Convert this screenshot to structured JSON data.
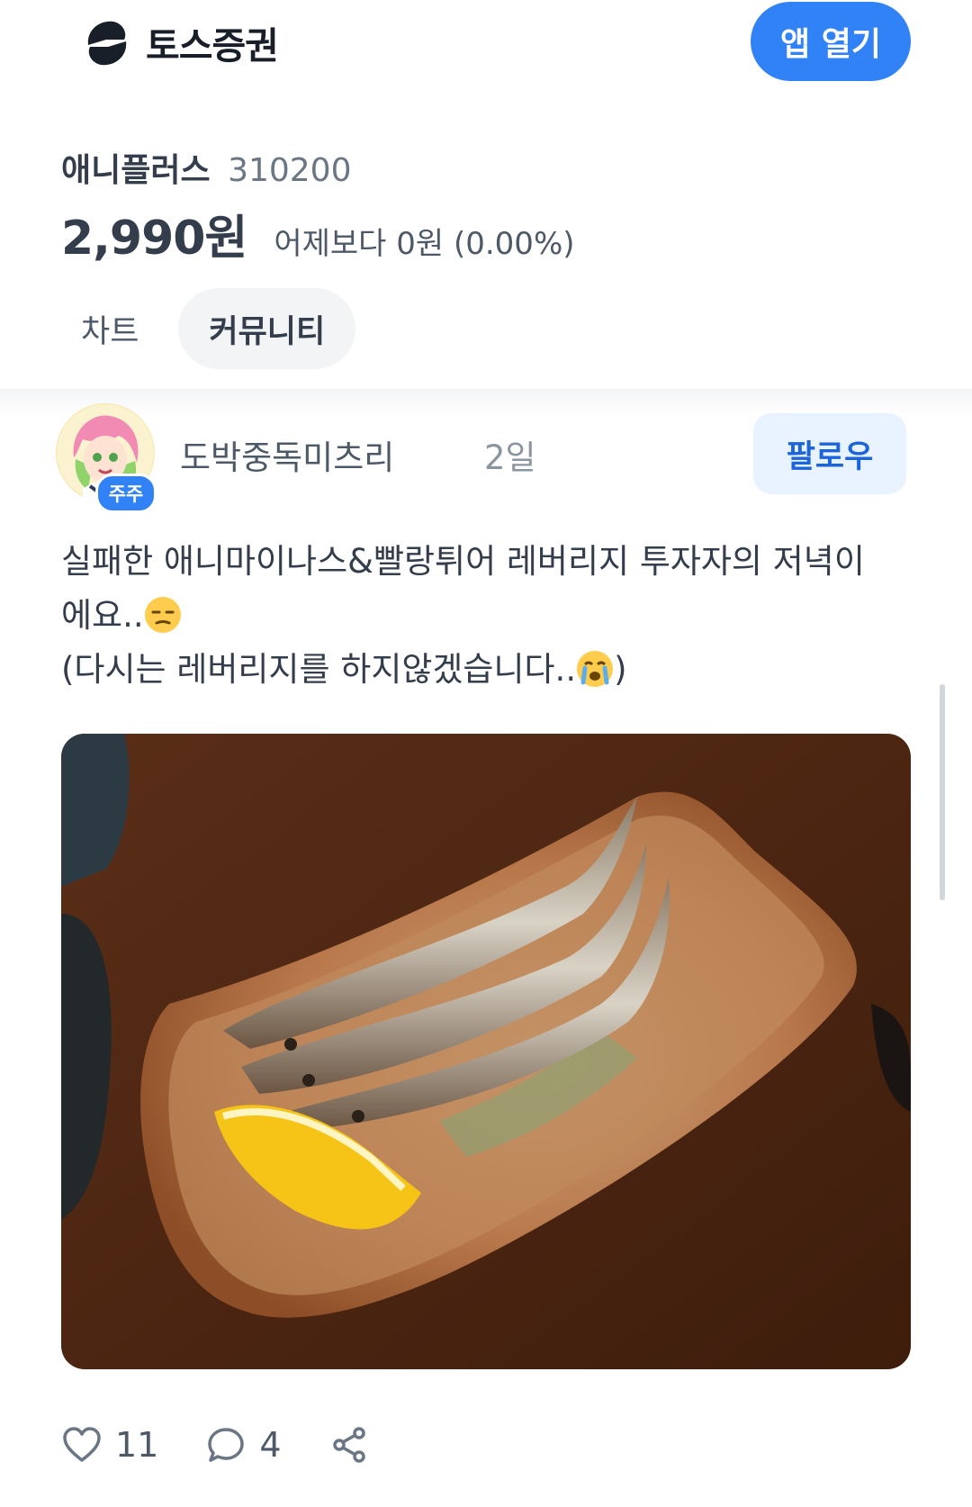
{
  "header": {
    "brand": "토스증권",
    "open_app_label": "앱 열기",
    "brand_color": "#3182f6"
  },
  "stock": {
    "name": "애니플러스",
    "code": "310200",
    "price": "2,990원",
    "change": "어제보다 0원 (0.00%)"
  },
  "tabs": [
    {
      "label": "차트",
      "active": false
    },
    {
      "label": "커뮤니티",
      "active": true
    }
  ],
  "post": {
    "author": "도박중독미츠리",
    "holder_badge": "주주",
    "time": "2일",
    "follow_label": "팔로우",
    "lines": [
      "실패한 애니마이나스&빨랑튀어 레버리지 투자자의 저녁이",
      "에요..",
      "(다시는 레버리지를 하지않겠습니다..",
      ")"
    ],
    "emoji": [
      "unamused-face-icon",
      "crying-face-icon"
    ],
    "image": "grilled-fish-with-lemon-photo",
    "likes": "11",
    "comments": "4"
  },
  "icons": [
    "toss-logo-icon",
    "heart-icon",
    "comment-icon",
    "share-icon"
  ]
}
